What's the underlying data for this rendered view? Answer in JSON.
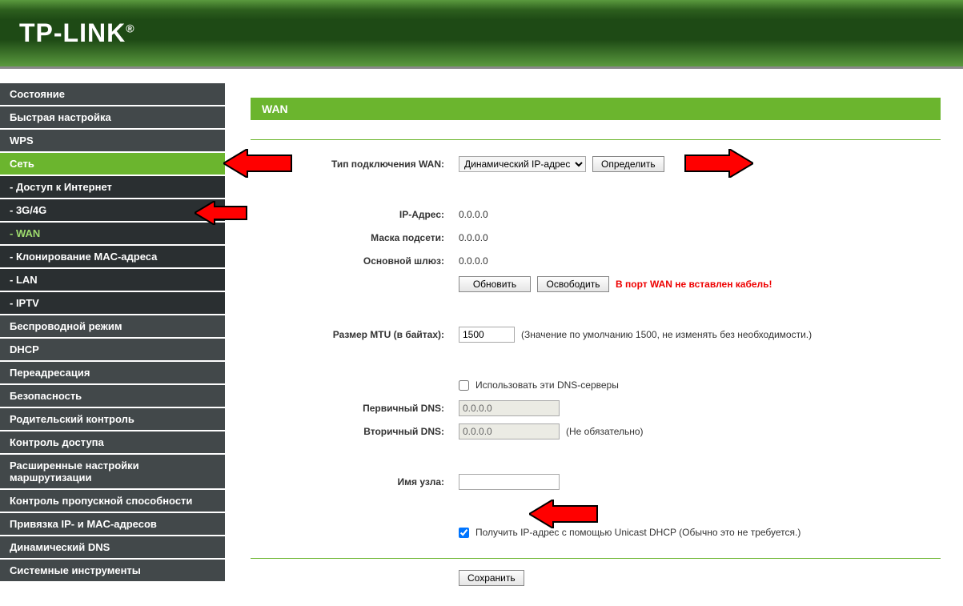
{
  "logo": "TP-LINK",
  "sidebar": {
    "items": [
      {
        "label": "Состояние",
        "type": "menu"
      },
      {
        "label": "Быстрая настройка",
        "type": "menu"
      },
      {
        "label": "WPS",
        "type": "menu"
      },
      {
        "label": "Сеть",
        "type": "menu",
        "active": true
      },
      {
        "label": "- Доступ к Интернет",
        "type": "sub"
      },
      {
        "label": "- 3G/4G",
        "type": "sub"
      },
      {
        "label": "- WAN",
        "type": "sub",
        "active": true
      },
      {
        "label": "- Клонирование MAC-адреса",
        "type": "sub"
      },
      {
        "label": "- LAN",
        "type": "sub"
      },
      {
        "label": "- IPTV",
        "type": "sub"
      },
      {
        "label": "Беспроводной режим",
        "type": "menu"
      },
      {
        "label": "DHCP",
        "type": "menu"
      },
      {
        "label": "Переадресация",
        "type": "menu"
      },
      {
        "label": "Безопасность",
        "type": "menu"
      },
      {
        "label": "Родительский контроль",
        "type": "menu"
      },
      {
        "label": "Контроль доступа",
        "type": "menu"
      },
      {
        "label": "Расширенные настройки маршрутизации",
        "type": "menu"
      },
      {
        "label": "Контроль пропускной способности",
        "type": "menu"
      },
      {
        "label": "Привязка IP- и MAC-адресов",
        "type": "menu"
      },
      {
        "label": "Динамический DNS",
        "type": "menu"
      },
      {
        "label": "Системные инструменты",
        "type": "menu"
      }
    ]
  },
  "page": {
    "title": "WAN",
    "conn_type_label": "Тип подключения WAN:",
    "conn_type_value": "Динамический IP-адрес",
    "detect_btn": "Определить",
    "ip_label": "IP-Адрес:",
    "ip_value": "0.0.0.0",
    "mask_label": "Маска подсети:",
    "mask_value": "0.0.0.0",
    "gateway_label": "Основной шлюз:",
    "gateway_value": "0.0.0.0",
    "refresh_btn": "Обновить",
    "release_btn": "Освободить",
    "cable_warn": "В порт WAN не вставлен кабель!",
    "mtu_label": "Размер MTU (в байтах):",
    "mtu_value": "1500",
    "mtu_hint": "(Значение по умолчанию 1500, не изменять без необходимости.)",
    "use_dns_label": "Использовать эти DNS-серверы",
    "dns1_label": "Первичный DNS:",
    "dns1_value": "0.0.0.0",
    "dns2_label": "Вторичный DNS:",
    "dns2_value": "0.0.0.0",
    "dns2_hint": "(Не обязательно)",
    "host_label": "Имя узла:",
    "host_value": "",
    "unicast_label": "Получить IP-адрес с помощью Unicast DHCP (Обычно это не требуется.)",
    "save_btn": "Сохранить"
  }
}
